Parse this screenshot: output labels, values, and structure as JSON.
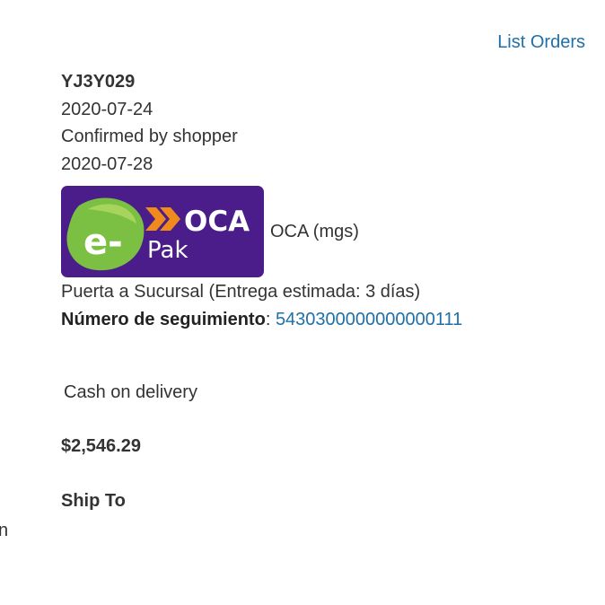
{
  "header": {
    "list_orders_label": "List Orders"
  },
  "order": {
    "id": "YJ3Y029",
    "order_date": "2020-07-24",
    "status": "Confirmed by shopper",
    "status_date": "2020-07-28"
  },
  "shipping": {
    "logo": {
      "text_top": "OCA",
      "text_bottom": "Pak",
      "badge_text": "e-",
      "background_color": "#4b1d8a",
      "accent_color": "#f08a1c",
      "badge_color": "#7bc043"
    },
    "carrier_name": "OCA (mgs)",
    "method": "Puerta a Sucursal (Entrega estimada: 3 días)",
    "tracking_label": "Número de seguimiento",
    "tracking_separator": ":",
    "tracking_number": "5430300000000000111"
  },
  "payment": {
    "method": "Cash on delivery"
  },
  "totals": {
    "total": "$2,546.29"
  },
  "address": {
    "ship_to_heading": "Ship To",
    "partial_text": "n"
  },
  "colors": {
    "link": "#1f6fa8",
    "text": "#333333"
  }
}
